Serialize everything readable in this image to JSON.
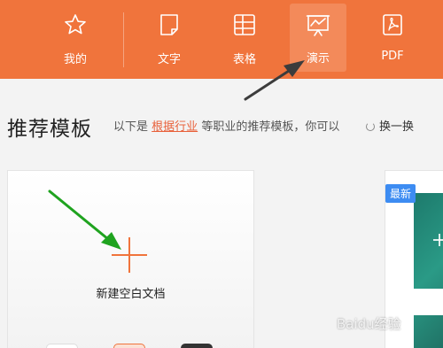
{
  "nav": {
    "items": [
      {
        "label": "我的",
        "icon": "star-icon"
      },
      {
        "label": "文字",
        "icon": "document-icon"
      },
      {
        "label": "表格",
        "icon": "spreadsheet-icon"
      },
      {
        "label": "演示",
        "icon": "presentation-icon",
        "active": true
      },
      {
        "label": "PDF",
        "icon": "pdf-icon"
      }
    ]
  },
  "section": {
    "title": "推荐模板",
    "desc_prefix": "以下是",
    "desc_link": "根据行业",
    "desc_suffix": "等职业的推荐模板，你可以",
    "refresh_label": "换一换"
  },
  "blank_card": {
    "label": "新建空白文档"
  },
  "template_card": {
    "badge": "最新"
  },
  "watermark": "Baidu经验",
  "colors": {
    "accent": "#f0743c",
    "badge": "#3d8cf2",
    "arrow_green": "#1fa31f"
  }
}
